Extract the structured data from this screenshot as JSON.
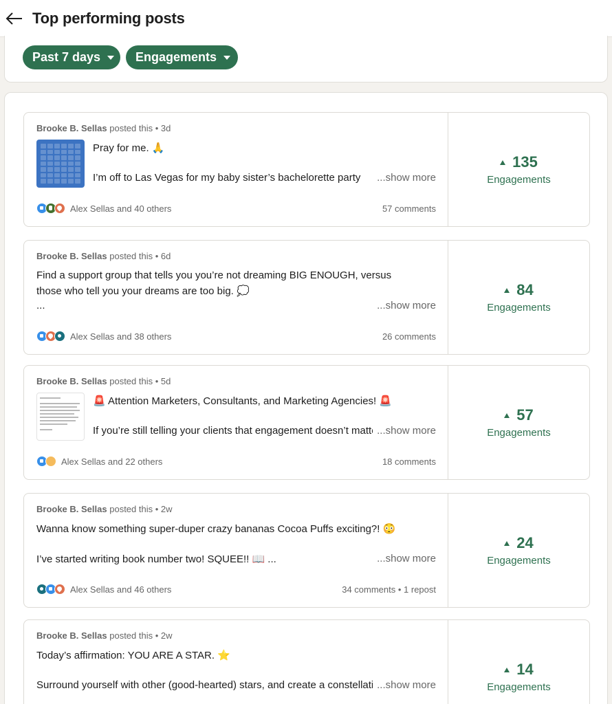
{
  "header": {
    "title": "Top performing posts"
  },
  "filters": {
    "period": "Past 7 days",
    "metric": "Engagements"
  },
  "posts": [
    {
      "author": "Brooke B. Sellas",
      "action": "posted this",
      "age": "3d",
      "lines": [
        "Pray for me. 🙏",
        "I’m off to Las Vegas for my baby sister’s bachelorette party"
      ],
      "show_more": "...show more",
      "reactions": [
        "like-icon",
        "celebrate-icon",
        "love-icon"
      ],
      "reactors": "Alex Sellas and 40 others",
      "comments": "57 comments",
      "value": "135",
      "metric": "Engagements"
    },
    {
      "author": "Brooke B. Sellas",
      "action": "posted this",
      "age": "6d",
      "lines": [
        "Find a support group that tells you you’re not dreaming BIG ENOUGH, versus",
        "those who tell you your dreams are too big. 💭",
        "..."
      ],
      "show_more": "...show more",
      "reactions": [
        "like-icon",
        "love-icon",
        "funny-icon"
      ],
      "reactors": "Alex Sellas and 38 others",
      "comments": "26 comments",
      "value": "84",
      "metric": "Engagements"
    },
    {
      "author": "Brooke B. Sellas",
      "action": "posted this",
      "age": "5d",
      "lines": [
        "🚨 Attention Marketers, Consultants, and Marketing Agencies! 🚨",
        "If you’re still telling your clients that engagement doesn’t matter"
      ],
      "show_more": "...show more",
      "reactions": [
        "like-icon",
        "insight-icon"
      ],
      "reactors": "Alex Sellas and 22 others",
      "comments": "18 comments",
      "value": "57",
      "metric": "Engagements"
    },
    {
      "author": "Brooke B. Sellas",
      "action": "posted this",
      "age": "2w",
      "lines": [
        "Wanna know something super-duper crazy bananas Cocoa Puffs exciting?! 😳",
        "I’ve started writing book number two! SQUEE!! 📖 ..."
      ],
      "show_more": "...show more",
      "reactions": [
        "funny-icon",
        "like-icon",
        "love-icon"
      ],
      "reactors": "Alex Sellas and 46 others",
      "comments": "34 comments • 1 repost",
      "value": "24",
      "metric": "Engagements"
    },
    {
      "author": "Brooke B. Sellas",
      "action": "posted this",
      "age": "2w",
      "lines": [
        "Today’s affirmation: YOU ARE A STAR. ⭐",
        "Surround yourself with other (good-hearted) stars, and create a constellation"
      ],
      "show_more": "...show more",
      "value": "14",
      "metric": "Engagements"
    }
  ],
  "colors": {
    "accent": "#2e7150",
    "page_bg": "#f4f2ee",
    "card_bg": "#ffffff",
    "muted_text": "#666666"
  }
}
